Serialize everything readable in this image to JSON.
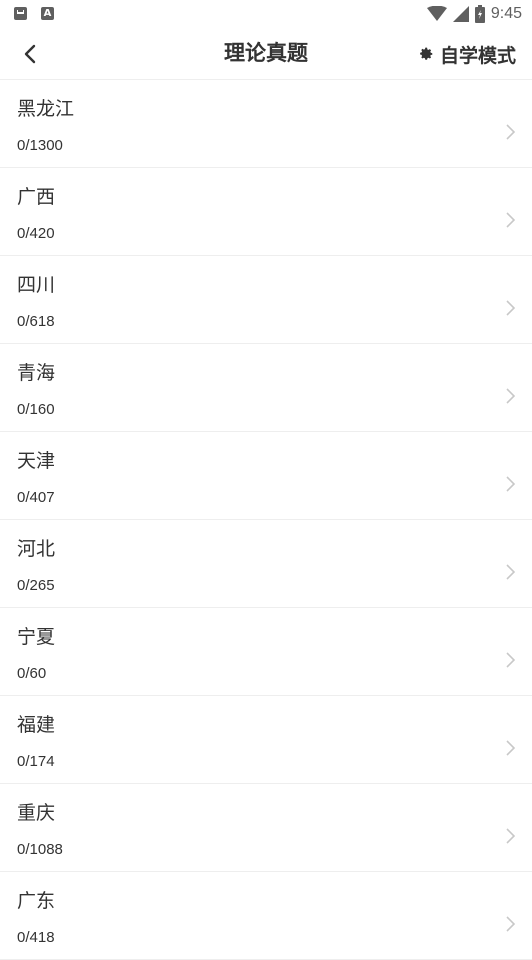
{
  "status_bar": {
    "time": "9:45",
    "icons": [
      "message-icon",
      "a-icon",
      "wifi-icon",
      "signal-icon",
      "battery-icon"
    ]
  },
  "header": {
    "title": "理论真题",
    "mode_label": "自学模式"
  },
  "items": [
    {
      "name": "黑龙江",
      "count": "0/1300"
    },
    {
      "name": "广西",
      "count": "0/420"
    },
    {
      "name": "四川",
      "count": "0/618"
    },
    {
      "name": "青海",
      "count": "0/160"
    },
    {
      "name": "天津",
      "count": "0/407"
    },
    {
      "name": "河北",
      "count": "0/265"
    },
    {
      "name": "宁夏",
      "count": "0/60"
    },
    {
      "name": "福建",
      "count": "0/174"
    },
    {
      "name": "重庆",
      "count": "0/1088"
    },
    {
      "name": "广东",
      "count": "0/418"
    }
  ],
  "colors": {
    "text": "#333333",
    "divider": "#eeeeee",
    "chevron": "#c8c8c8",
    "status_icon": "#5f5f5f"
  }
}
